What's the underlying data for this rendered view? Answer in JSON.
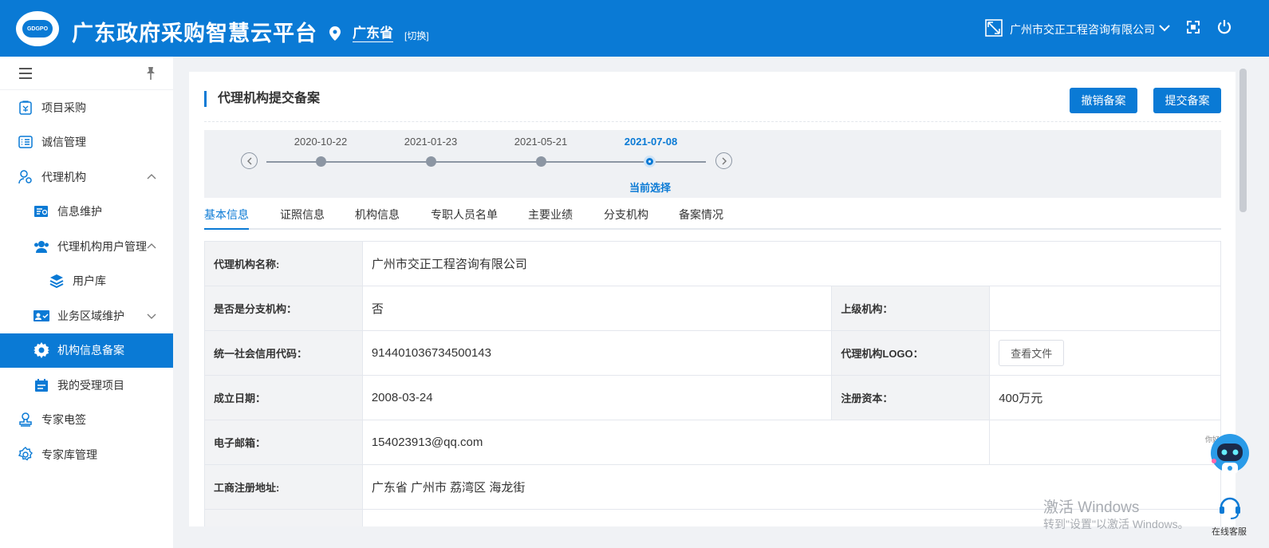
{
  "header": {
    "logo_text": "GDGPO",
    "app_title": "广东政府采购智慧云平台",
    "region": "广东省",
    "switch_label": "[切换]",
    "company": "广州市交正工程咨询有限公司"
  },
  "sidebar": {
    "items": [
      {
        "label": "项目采购"
      },
      {
        "label": "诚信管理"
      },
      {
        "label": "代理机构"
      },
      {
        "label": "信息维护"
      },
      {
        "label": "代理机构用户管理"
      },
      {
        "label": "用户库"
      },
      {
        "label": "业务区域维护"
      },
      {
        "label": "机构信息备案"
      },
      {
        "label": "我的受理项目"
      },
      {
        "label": "专家电签"
      },
      {
        "label": "专家库管理"
      }
    ]
  },
  "page": {
    "title": "代理机构提交备案",
    "revoke_button": "撤销备案",
    "submit_button": "提交备案"
  },
  "timeline": {
    "dates": [
      "2020-10-22",
      "2021-01-23",
      "2021-05-21",
      "2021-07-08"
    ],
    "current_label": "当前选择"
  },
  "tabs": [
    "基本信息",
    "证照信息",
    "机构信息",
    "专职人员名单",
    "主要业绩",
    "分支机构",
    "备案情况"
  ],
  "info": {
    "name_key": "代理机构名称:",
    "name_value": "广州市交正工程咨询有限公司",
    "branch_key": "是否是分支机构：",
    "branch_value": "否",
    "parent_key": "上级机构：",
    "credit_key": "统一社会信用代码：",
    "credit_value": "914401036734500143",
    "logo_key": "代理机构LOGO：",
    "logo_button": "查看文件",
    "date_key": "成立日期：",
    "date_value": "2008-03-24",
    "capital_key": "注册资本：",
    "capital_value": "400万元",
    "email_key": "电子邮箱：",
    "email_value": "154023913@qq.com",
    "address_key": "工商注册地址:",
    "address_value": "广东省 广州市 荔湾区 海龙街"
  },
  "widgets": {
    "robot_greeting": "你好!",
    "service_label": "在线客服",
    "watermark_title": "激活 Windows",
    "watermark_sub": "转到\"设置\"以激活 Windows。"
  },
  "colors": {
    "primary": "#0a7ad5",
    "key_cell_bg": "#f2f3f5",
    "timeline_bg": "#eff1f4"
  }
}
